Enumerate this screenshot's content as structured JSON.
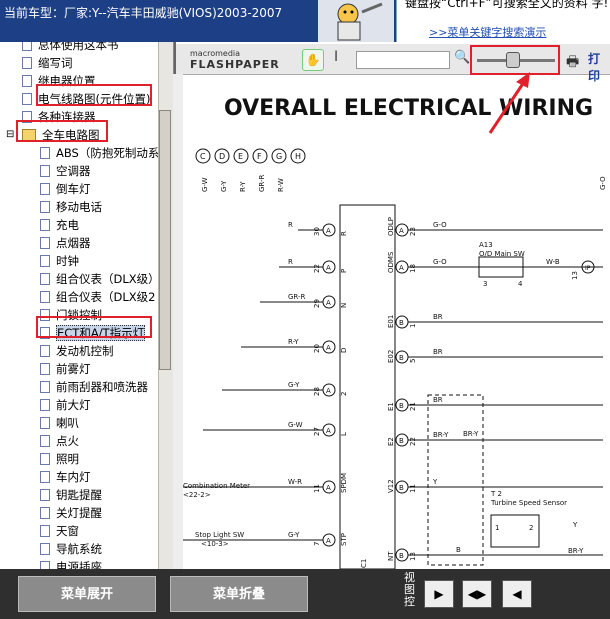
{
  "header": {
    "car_title": "当前车型：厂家:Y--汽车丰田威驰(VIOS)2003-2007",
    "tip_text": "键盘按“Ctrl+F”可搜索全文的资料 字!",
    "tip_link": ">>菜单关键字搜索演示"
  },
  "tree": {
    "items": [
      {
        "label": "总体使用这本书",
        "level": 2
      },
      {
        "label": "缩写词",
        "level": 2
      },
      {
        "label": "继电器位置",
        "level": 2
      },
      {
        "label": "电气线路图(元件位置)",
        "level": 2
      },
      {
        "label": "各种连接器",
        "level": 2
      },
      {
        "label": "全车电路图",
        "level": 1
      },
      {
        "label": "ABS（防抱死制动系",
        "level": 3
      },
      {
        "label": "空调器",
        "level": 3
      },
      {
        "label": "倒车灯",
        "level": 3
      },
      {
        "label": "移动电话",
        "level": 3
      },
      {
        "label": "充电",
        "level": 3
      },
      {
        "label": "点烟器",
        "level": 3
      },
      {
        "label": "时钟",
        "level": 3
      },
      {
        "label": "组合仪表（DLX级）",
        "level": 3
      },
      {
        "label": "组合仪表（DLX级2",
        "level": 3
      },
      {
        "label": "门锁控制",
        "level": 3
      },
      {
        "label": "ECT和A/T指示灯",
        "level": 3,
        "selected": true
      },
      {
        "label": "发动机控制",
        "level": 3
      },
      {
        "label": "前雾灯",
        "level": 3
      },
      {
        "label": "前雨刮器和喷洗器",
        "level": 3
      },
      {
        "label": "前大灯",
        "level": 3
      },
      {
        "label": "喇叭",
        "level": 3
      },
      {
        "label": "点火",
        "level": 3
      },
      {
        "label": "照明",
        "level": 3
      },
      {
        "label": "车内灯",
        "level": 3
      },
      {
        "label": "钥匙提醒",
        "level": 3
      },
      {
        "label": "关灯提醒",
        "level": 3
      },
      {
        "label": "天窗",
        "level": 3
      },
      {
        "label": "导航系统",
        "level": 3
      },
      {
        "label": "电源插座",
        "level": 3
      }
    ]
  },
  "viewer": {
    "logo_small": "macromedia",
    "logo_big": "FLASHPAPER",
    "print_label": "打印",
    "zoom_value": "",
    "document_title": "OVERALL ELECTRICAL WIRING"
  },
  "diagram": {
    "connectors_top": [
      "C",
      "D",
      "E",
      "F",
      "G",
      "H"
    ],
    "left_wires": [
      "G-W",
      "G-Y",
      "R-Y",
      "GR-R",
      "R-W"
    ],
    "ecu_pins": [
      {
        "num": "30",
        "conn": "A",
        "name": "R"
      },
      {
        "num": "22",
        "conn": "A",
        "name": "P"
      },
      {
        "num": "29",
        "conn": "A",
        "name": "N"
      },
      {
        "num": "20",
        "conn": "A",
        "name": "D"
      },
      {
        "num": "28",
        "conn": "A",
        "name": "2"
      },
      {
        "num": "27",
        "conn": "A",
        "name": "L"
      },
      {
        "num": "11",
        "conn": "A",
        "name": "SPDM"
      },
      {
        "num": "7",
        "conn": "A",
        "name": "STP"
      }
    ],
    "ecu_right_pins": [
      {
        "num": "23",
        "conn": "A",
        "name": "ODLP"
      },
      {
        "num": "18",
        "conn": "A",
        "name": "ODMS"
      },
      {
        "num": "1",
        "conn": "B",
        "name": "E01"
      },
      {
        "num": "5",
        "conn": "B",
        "name": "E02"
      },
      {
        "num": "21",
        "conn": "B",
        "name": "E1"
      },
      {
        "num": "22",
        "conn": "B",
        "name": "E2"
      },
      {
        "num": "11",
        "conn": "B",
        "name": "V12"
      },
      {
        "num": "13",
        "conn": "B",
        "name": "NT"
      }
    ],
    "left_pin_wires": [
      "R",
      "R",
      "GR-R",
      "R-Y",
      "G-Y",
      "G-W",
      "W-R",
      "G-Y"
    ],
    "right_pin_wires": [
      "G-O",
      "G-O",
      "BR",
      "BR",
      "BR",
      "BR-Y",
      "Y",
      ""
    ],
    "main_sw_label": "A13",
    "main_sw_name": "O/D Main SW",
    "main_sw_wire": "W-B",
    "main_sw_pins": [
      "3",
      "4"
    ],
    "ip_label": "13",
    "ip_conn": "IP",
    "combo_meter": "Combination Meter",
    "combo_ref": "<22-2>",
    "stop_light": "Stop Light SW",
    "stop_ref": "<10-3>",
    "speed_sensor_id": "T 2",
    "speed_sensor_name": "Turbine Speed Sensor",
    "speed_sensor_pins": [
      "1",
      "2"
    ],
    "br_y": "BR-Y",
    "y": "Y",
    "b": "B",
    "right_edge_label": "G-O",
    "ecu_label": "C1 ECU",
    "ecu_prefix": "C1"
  },
  "bottom": {
    "expand_label": "菜单展开",
    "collapse_label": "菜单折叠",
    "view_label": "视图控"
  },
  "colors": {
    "header_bg": "#1d3f86",
    "annotation": "#e0202a",
    "bottom_bg": "#2f2f2f"
  }
}
